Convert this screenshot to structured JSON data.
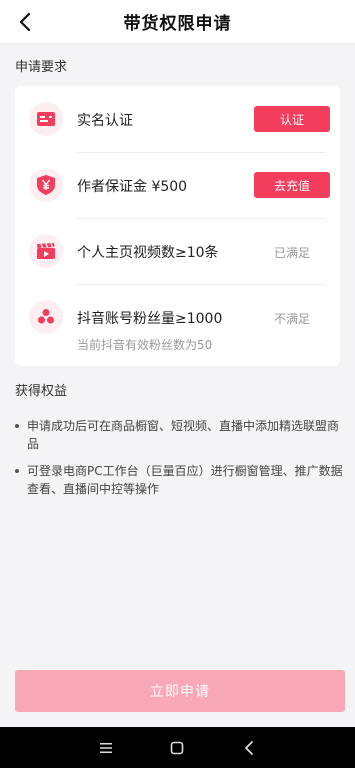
{
  "header": {
    "title": "带货权限申请"
  },
  "requirements": {
    "section_label": "申请要求",
    "items": [
      {
        "icon": "id-card-icon",
        "label": "实名认证",
        "action_label": "认证"
      },
      {
        "icon": "yuan-shield-icon",
        "label": "作者保证金 ¥500",
        "action_label": "去充值"
      },
      {
        "icon": "video-clapper-icon",
        "label": "个人主页视频数≥10条",
        "status": "已满足"
      },
      {
        "icon": "fans-icon",
        "label": "抖音账号粉丝量≥1000",
        "status": "不满足",
        "note": "当前抖音有效粉丝数为50"
      }
    ]
  },
  "benefits": {
    "section_label": "获得权益",
    "items": [
      "申请成功后可在商品橱窗、短视频、直播中添加精选联盟商品",
      "可登录电商PC工作台（巨量百应）进行橱窗管理、推广数据查看、直播间中控等操作"
    ]
  },
  "footer": {
    "apply_label": "立即申请"
  },
  "colors": {
    "accent": "#f43c5c",
    "accent_disabled": "#f8a8b6",
    "icon_bg": "#fdeef1"
  }
}
